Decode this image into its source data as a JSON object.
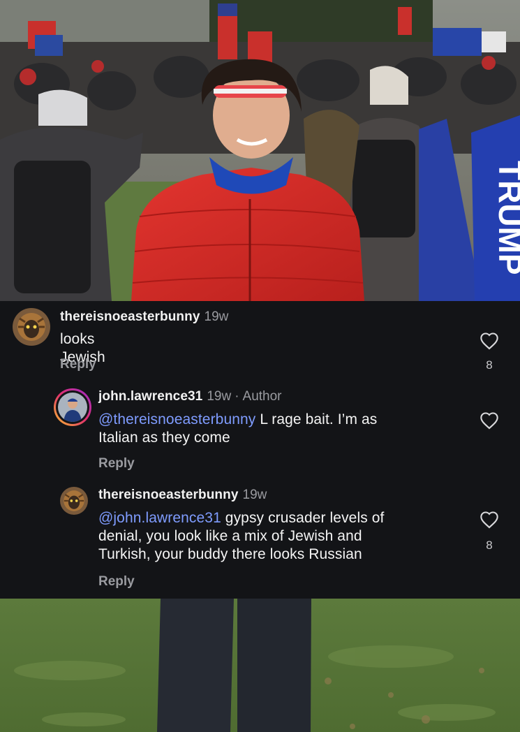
{
  "comments": [
    {
      "username": "thereisnoeasterbunny",
      "timestamp": "19w",
      "mention": "",
      "text": "looks Jewish",
      "reply_label": "Reply",
      "like_count": "8",
      "like_icon": "heart-outline-icon"
    },
    {
      "username": "john.lawrence31",
      "timestamp": "19w",
      "separator": "·",
      "author_label": "Author",
      "mention": "@thereisnoeasterbunny",
      "text_line1": " L rage bait. I’m as",
      "text_line2": "Italian as they come",
      "reply_label": "Reply",
      "like_count": "",
      "like_icon": "heart-outline-icon"
    },
    {
      "username": "thereisnoeasterbunny",
      "timestamp": "19w",
      "mention": "@john.lawrence31",
      "text_line1": " gypsy crusader levels of",
      "text_line2": "denial, you look like a mix of Jewish and",
      "text_line3": "Turkish, your buddy there looks Russian",
      "reply_label": "Reply",
      "like_count": "8",
      "like_icon": "heart-outline-icon"
    }
  ],
  "colors": {
    "panel_bg": "#131417",
    "username": "#f2f2f2",
    "secondary_text": "#9a9ba0",
    "mention": "#7f9cff",
    "story_ring_start": "#f9c22e",
    "story_ring_end": "#d3279b"
  }
}
